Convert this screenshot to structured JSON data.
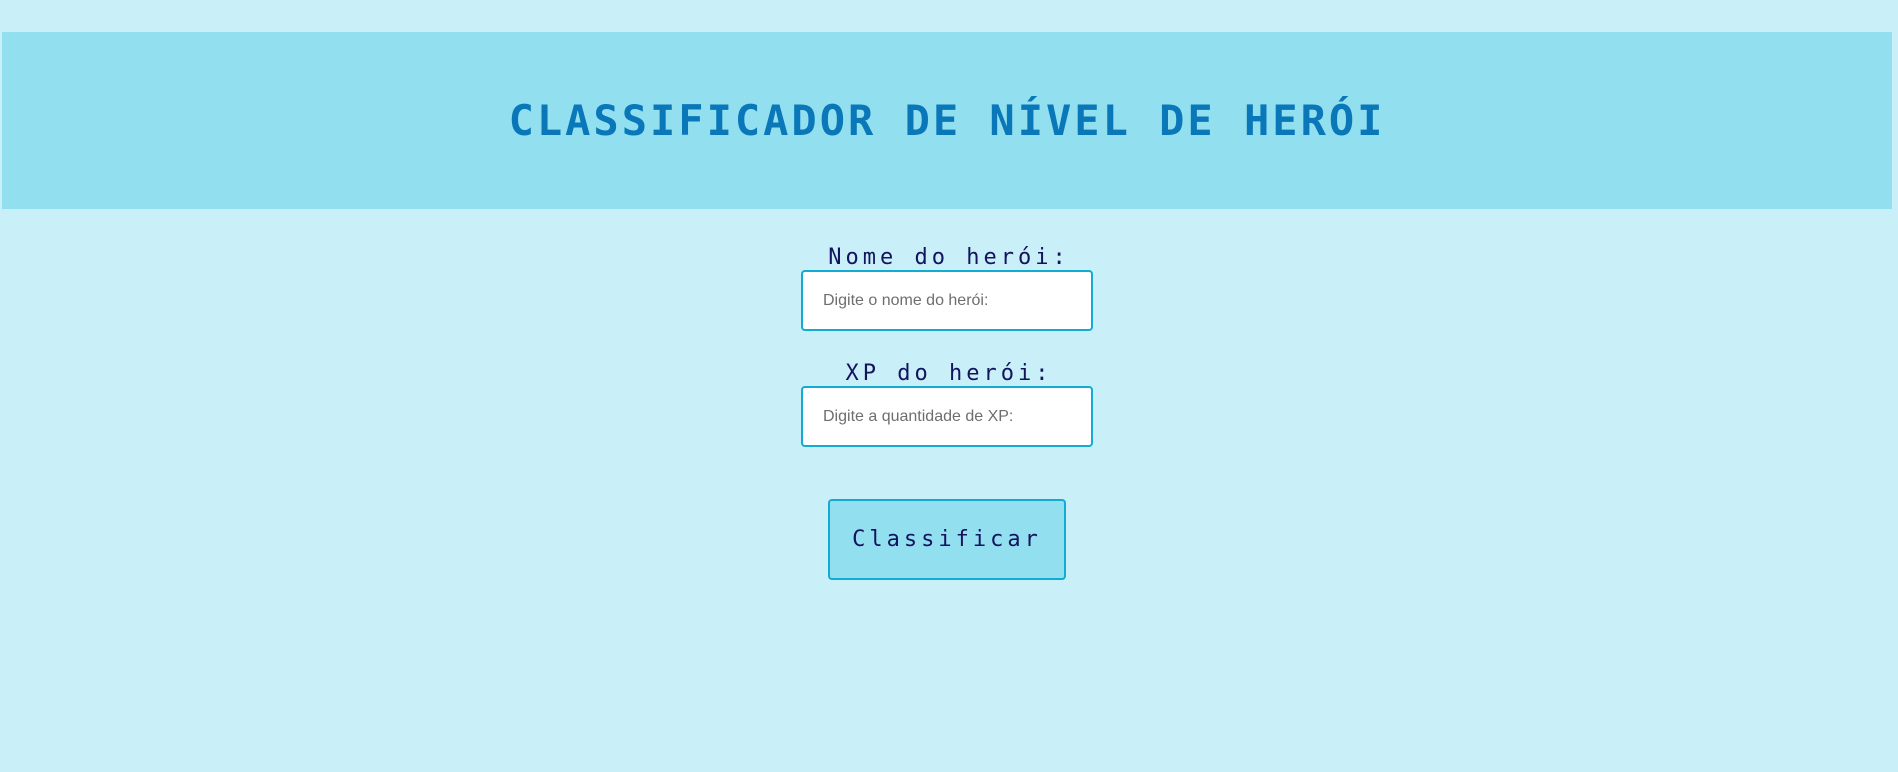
{
  "header": {
    "title": "Classificador de Nível de Herói"
  },
  "form": {
    "name_field": {
      "label": "Nome do herói:",
      "placeholder": "Digite o nome do herói:",
      "value": ""
    },
    "xp_field": {
      "label": "XP do herói:",
      "placeholder": "Digite a quantidade de XP:",
      "value": ""
    },
    "submit_label": "Classificar"
  },
  "colors": {
    "page_background": "#c9f0f8",
    "header_background": "#92e0ef",
    "title_color": "#0a77b9",
    "label_color": "#13135e",
    "border_color": "#13aad4",
    "button_background": "#92e0ef"
  }
}
